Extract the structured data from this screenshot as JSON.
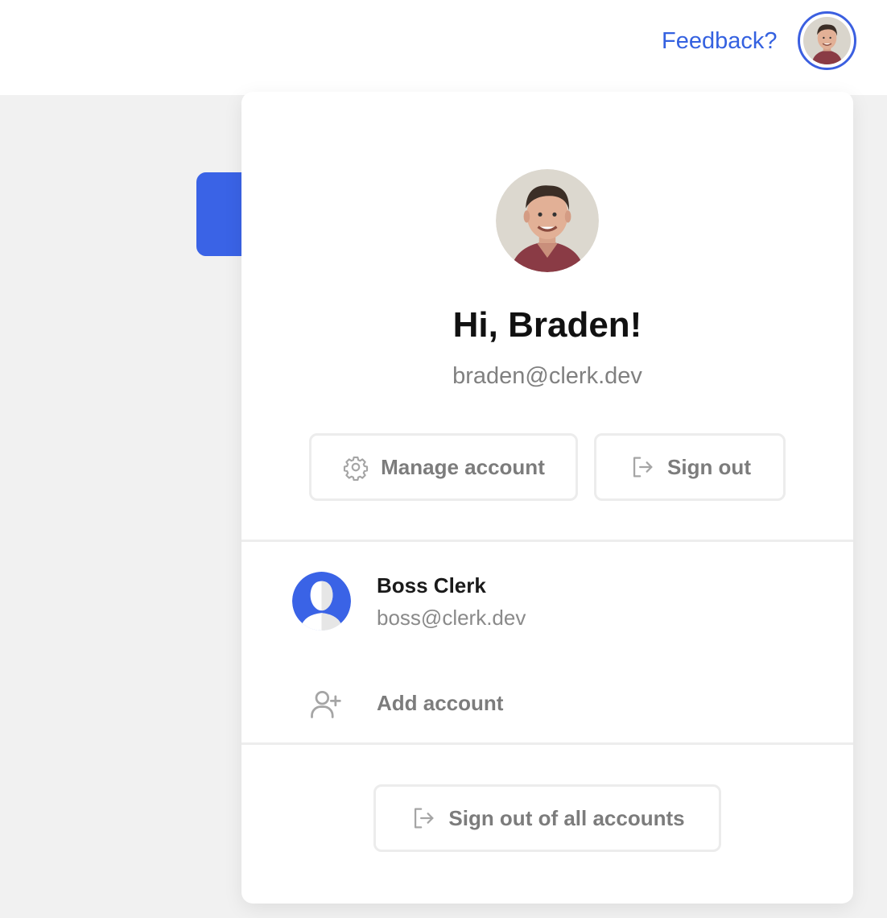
{
  "header": {
    "feedback_label": "Feedback?",
    "avatar_icon": "user-photo-avatar"
  },
  "profile": {
    "greeting": "Hi, Braden!",
    "email": "braden@clerk.dev",
    "avatar_icon": "user-photo-avatar"
  },
  "actions": {
    "manage_label": "Manage account",
    "manage_icon": "gear-icon",
    "signout_label": "Sign out",
    "signout_icon": "sign-out-icon"
  },
  "other_accounts": [
    {
      "name": "Boss Clerk",
      "email": "boss@clerk.dev",
      "avatar_icon": "default-user-avatar"
    }
  ],
  "add_account": {
    "label": "Add account",
    "icon": "add-user-icon"
  },
  "footer": {
    "signout_all_label": "Sign out of all accounts",
    "icon": "sign-out-icon"
  },
  "colors": {
    "accent": "#3461e0",
    "tab": "#3a63e6",
    "muted_text": "#7c7c7c",
    "border": "#ececec",
    "background": "#f1f1f1"
  }
}
